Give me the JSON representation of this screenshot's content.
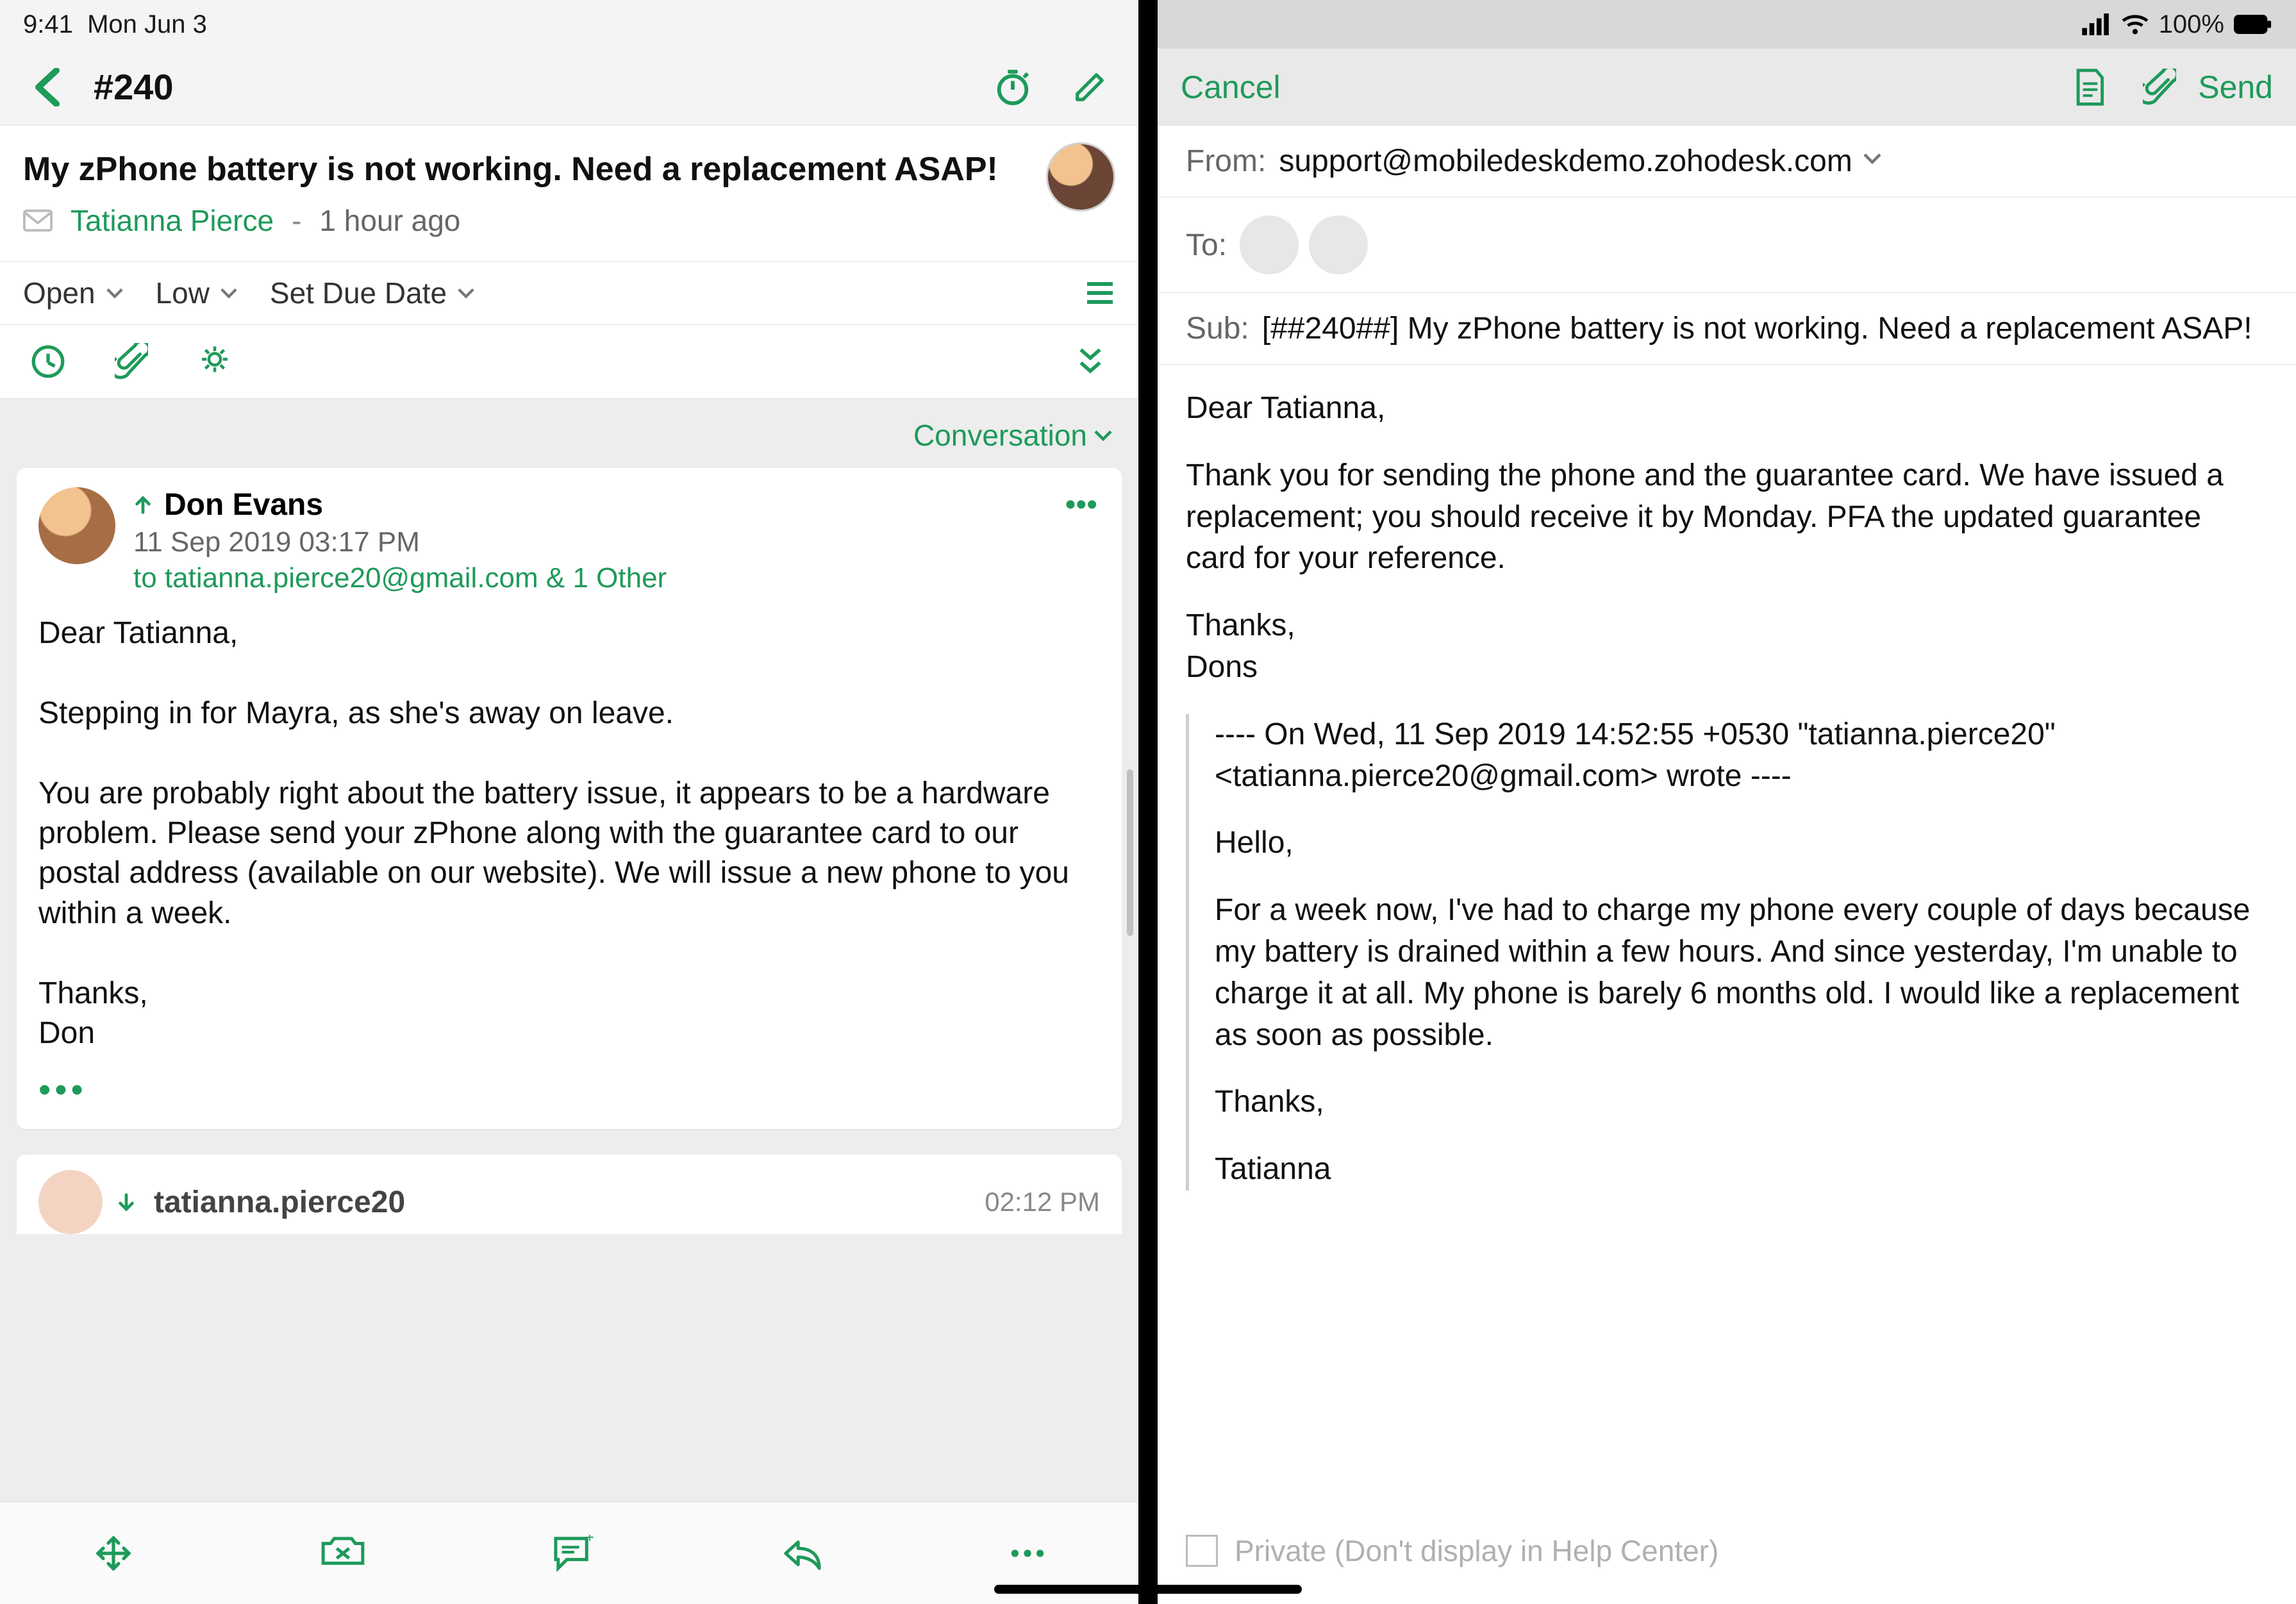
{
  "status_bar": {
    "time": "9:41",
    "date": "Mon Jun 3",
    "battery_pct": "100%"
  },
  "left": {
    "nav_title": "#240",
    "ticket": {
      "subject": "My zPhone battery is not working. Need a replacement ASAP!",
      "contact": "Tatianna Pierce",
      "dash": "-",
      "time_ago": "1 hour ago"
    },
    "status": {
      "state": "Open",
      "priority": "Low",
      "due": "Set Due Date"
    },
    "view_mode": "Conversation",
    "thread": {
      "msg1": {
        "sender": "Don Evans",
        "timestamp": "11 Sep 2019 03:17 PM",
        "to_line": "to tatianna.pierce20@gmail.com  & 1 Other",
        "body": "Dear Tatianna,\n\nStepping in for Mayra, as she's away on leave.\n\nYou are probably right about the battery issue, it appears to be a hardware problem. Please send your zPhone along with the guarantee card to our postal address (available on our website). We will issue a new phone to you within a week.\n\nThanks,\nDon"
      },
      "peek": {
        "name": "tatianna.pierce20",
        "time": "02:12 PM"
      }
    }
  },
  "right": {
    "cancel": "Cancel",
    "send": "Send",
    "from_label": "From:",
    "from_value": "support@mobiledeskdemo.zohodesk.com",
    "to_label": "To:",
    "sub_label": "Sub:",
    "sub_value": "[##240##] My zPhone battery is not working. Need a replacement ASAP!",
    "body": {
      "greeting": "Dear Tatianna,",
      "p1": "Thank you for sending the phone and the guarantee card. We have issued a replacement; you should receive it by Monday. PFA the updated guarantee card for your reference.",
      "thanks": "Thanks,",
      "sign": "Dons",
      "quote_header": "---- On Wed, 11 Sep 2019 14:52:55 +0530 \"tatianna.pierce20\" <tatianna.pierce20@gmail.com> wrote ----",
      "q_hello": "Hello,",
      "q_body": "For a week now, I've had to charge my phone every couple of days because my battery is drained within a few hours. And since yesterday, I'm unable to charge it at all. My phone is barely 6 months old. I would like a replacement as soon as possible.",
      "q_thanks": "Thanks,",
      "q_sign": "Tatianna"
    },
    "private_label": "Private (Don't display in Help Center)"
  }
}
